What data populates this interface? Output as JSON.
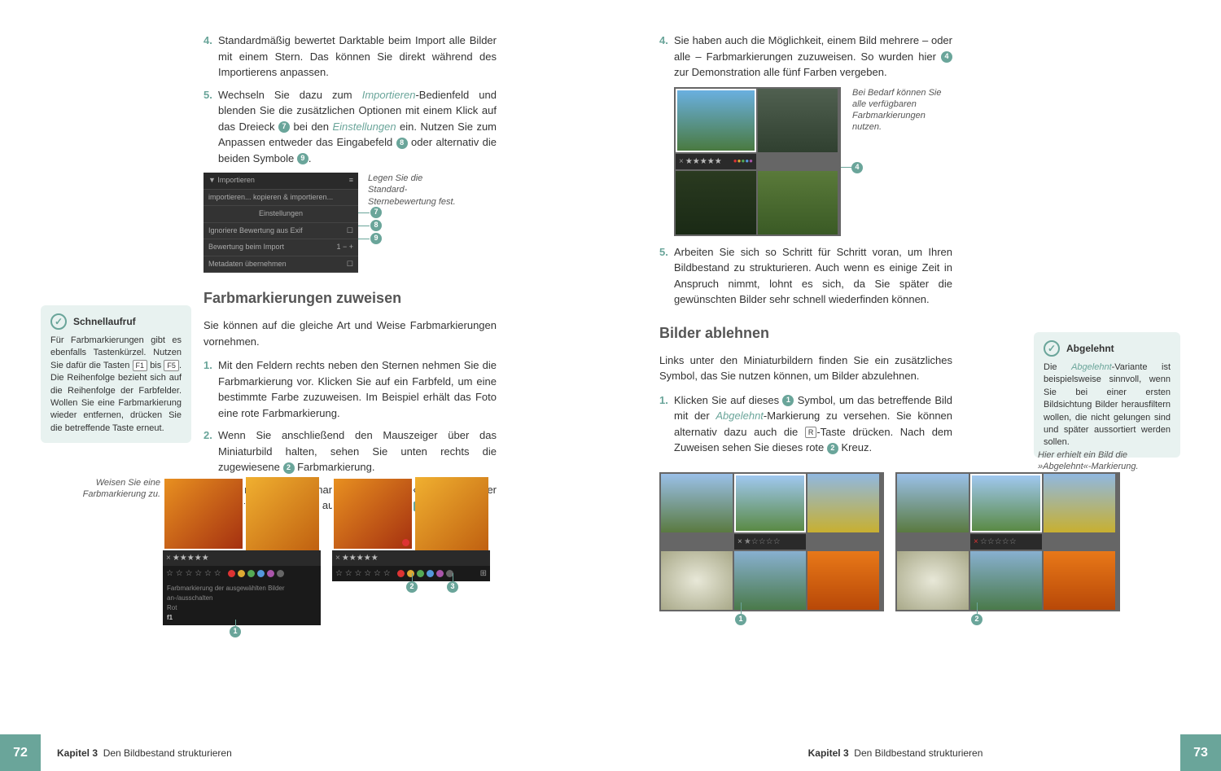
{
  "leftPage": {
    "steps_top": [
      {
        "num": "4.",
        "text": "Standardmäßig bewertet Darktable beim Import alle Bilder mit einem Stern. Das können Sie direkt während des Importierens anpassen."
      },
      {
        "num": "5.",
        "text_parts": [
          "Wechseln Sie dazu zum ",
          "Importieren",
          "-Bedienfeld und blenden Sie die zusätzlichen Optionen mit einem Klick auf das Dreieck ",
          "7",
          " bei den ",
          "Einstellungen",
          " ein. Nutzen Sie zum Anpassen entweder das Eingabefeld ",
          "8",
          " oder alternativ die beiden Symbole ",
          "9",
          "."
        ]
      }
    ],
    "fig1_caption": "Legen Sie die Standard-Sternebewertung fest.",
    "fig1_panel": {
      "title": "Importieren",
      "row1": "importieren...    kopieren & importieren...",
      "row2": "Einstellungen",
      "row3": "Ignoriere Bewertung aus Exif",
      "row4": "Bewertung beim Import",
      "row4_val": "1",
      "row5": "Metadaten übernehmen"
    },
    "h2a": "Farbmarkierungen zuweisen",
    "intro_a": "Sie können auf die gleiche Art und Weise Farbmarkierungen vornehmen.",
    "steps_mid": [
      {
        "num": "1.",
        "text": "Mit den Feldern rechts neben den Sternen nehmen Sie die Farbmarkierung vor. Klicken Sie auf ein Farbfeld, um eine bestimmte Farbe zuzuweisen. Im Beispiel erhält das Foto eine rote Farbmarkierung."
      },
      {
        "num": "2.",
        "text_parts": [
          "Wenn Sie anschließend den Mauszeiger über das Miniaturbild halten, sehen Sie unten rechts die zugewiesene ",
          "2",
          " Farbmarkierung."
        ]
      },
      {
        "num": "3.",
        "text_parts": [
          "Wollen Sie die vorhandenen Farbmarkierungen wieder entfernen, klicken Sie auf das letzte Feld ",
          "3",
          "."
        ]
      }
    ],
    "sidebar": {
      "title": "Schnellaufruf",
      "text_parts": [
        "Für Farbmarkierungen gibt es ebenfalls Tastenkürzel. Nutzen Sie dafür die Tasten ",
        "F1",
        " bis ",
        "F5",
        ". Die Reihenfolge bezieht sich auf die Reihenfolge der Farbfelder. Wollen Sie eine Farbmarkierung wieder entfernen, drücken Sie die betreffende Taste erneut."
      ]
    },
    "fig2_caption": "Weisen Sie eine Farbmarkierung zu.",
    "fig2_tooltip": "Farbmarkierung der ausgewählten Bilder an-/ausschalten",
    "fig2_tooltip2": "Rot",
    "fig2_tooltip3": "f1",
    "stars_label": "★★★★★",
    "footer": {
      "page": "72",
      "chapter": "Kapitel 3",
      "title": "Den Bildbestand strukturieren"
    }
  },
  "rightPage": {
    "steps_top": [
      {
        "num": "4.",
        "text_parts": [
          "Sie haben auch die Möglichkeit, einem Bild mehrere – oder alle – Farbmarkierungen zuzuweisen. So wurden hier ",
          "4",
          " zur Demonstration alle fünf Farben vergeben."
        ]
      }
    ],
    "fig3_caption": "Bei Bedarf können Sie alle verfügbaren Farbmarkierungen nutzen.",
    "steps_mid": [
      {
        "num": "5.",
        "text": "Arbeiten Sie sich so Schritt für Schritt voran, um Ihren Bildbestand zu strukturieren. Auch wenn es einige Zeit in Anspruch nimmt, lohnt es sich, da Sie später die gewünschten Bilder sehr schnell wiederfinden können."
      }
    ],
    "h2b": "Bilder ablehnen",
    "intro_b": "Links unter den Miniaturbildern finden Sie ein zusätzliches Symbol, das Sie nutzen können, um Bilder abzulehnen.",
    "steps_bottom": [
      {
        "num": "1.",
        "text_parts": [
          "Klicken Sie auf dieses ",
          "1",
          " Symbol, um das betreffende Bild mit der ",
          "Abgelehnt",
          "-Markierung zu versehen. Sie können alternativ dazu auch die ",
          "R",
          "-Taste drücken. Nach dem Zuweisen sehen Sie dieses rote ",
          "2",
          " Kreuz."
        ]
      }
    ],
    "sidebar": {
      "title": "Abgelehnt",
      "text_parts": [
        "Die ",
        "Abgelehnt",
        "-Variante ist beispielsweise sinnvoll, wenn Sie bei einer ersten Bildsichtung Bilder herausfiltern wollen, die nicht gelungen sind und später aussortiert werden sollen."
      ]
    },
    "fig4_caption": "Hier erhielt ein Bild die »Abgelehnt«-Markierung.",
    "footer": {
      "page": "73",
      "chapter": "Kapitel 3",
      "title": "Den Bildbestand strukturieren"
    }
  }
}
